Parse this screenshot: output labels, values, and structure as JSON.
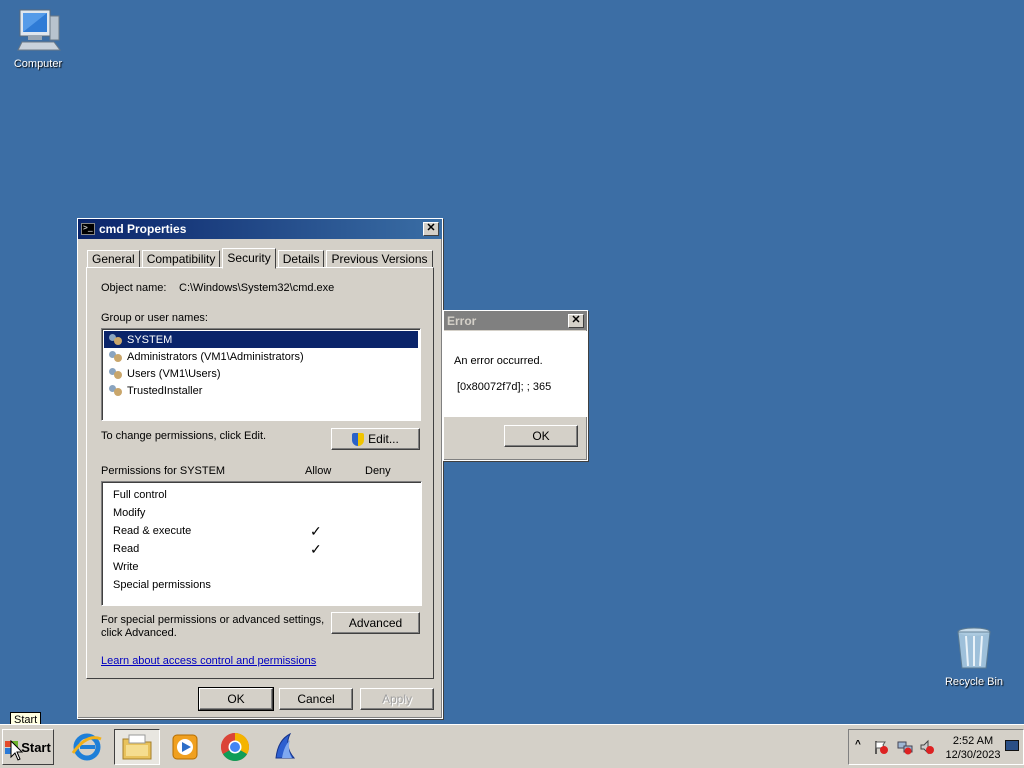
{
  "desktop": {
    "icons": [
      {
        "label": "Computer"
      },
      {
        "label": "Recycle Bin"
      }
    ]
  },
  "properties": {
    "title": "cmd Properties",
    "tabs": [
      "General",
      "Compatibility",
      "Security",
      "Details",
      "Previous Versions"
    ],
    "selected_tab": "Security",
    "object_name_label": "Object name:",
    "object_name_value": "C:\\Windows\\System32\\cmd.exe",
    "group_label": "Group or user names:",
    "users": [
      "SYSTEM",
      "Administrators (VM1\\Administrators)",
      "Users (VM1\\Users)",
      "TrustedInstaller"
    ],
    "change_perm_text": "To change permissions, click Edit.",
    "edit_label": "Edit...",
    "permissions_for": "Permissions for SYSTEM",
    "allow_header": "Allow",
    "deny_header": "Deny",
    "permissions": [
      {
        "name": "Full control",
        "allow": "",
        "deny": ""
      },
      {
        "name": "Modify",
        "allow": "",
        "deny": ""
      },
      {
        "name": "Read & execute",
        "allow": "✓",
        "deny": ""
      },
      {
        "name": "Read",
        "allow": "✓",
        "deny": ""
      },
      {
        "name": "Write",
        "allow": "",
        "deny": ""
      },
      {
        "name": "Special permissions",
        "allow": "",
        "deny": ""
      }
    ],
    "special_text_1": "For special permissions or advanced settings,",
    "special_text_2": "click Advanced.",
    "advanced_label": "Advanced",
    "learn_link": "Learn about access control and permissions",
    "ok_label": "OK",
    "cancel_label": "Cancel",
    "apply_label": "Apply"
  },
  "error_dialog": {
    "title": "Error",
    "message": "An error occurred.",
    "code": "[0x80072f7d]; ; 365",
    "ok_label": "OK"
  },
  "taskbar": {
    "start_label": "Start",
    "tooltip": "Start",
    "time": "2:52 AM",
    "date": "12/30/2023",
    "apps": [
      "internet-explorer-icon",
      "file-explorer-icon",
      "media-player-icon",
      "chrome-icon",
      "app-sail-icon"
    ]
  },
  "colors": {
    "desktop": "#3c6ea5",
    "title_active": "#0a246a",
    "selection": "#0a246a",
    "link": "#0000c0"
  }
}
